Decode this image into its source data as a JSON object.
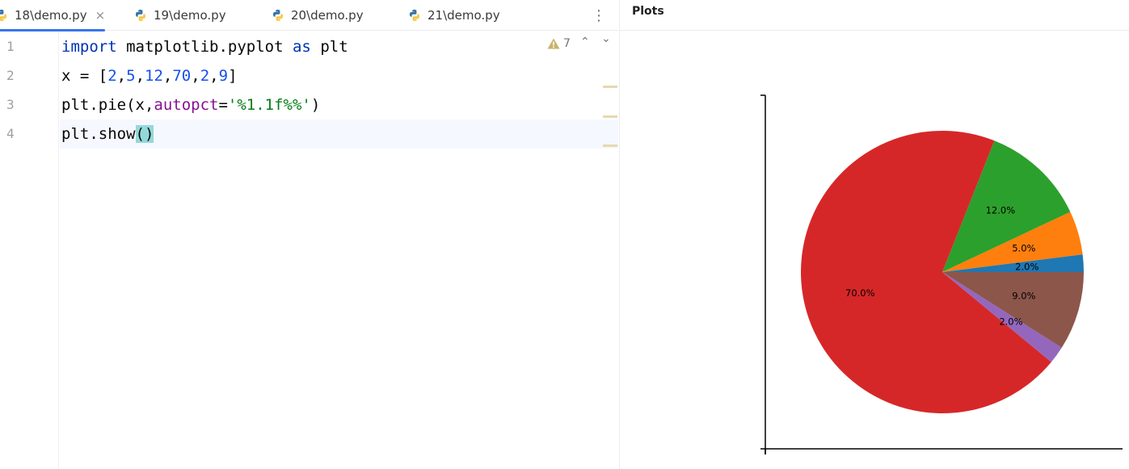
{
  "editor": {
    "tabs": [
      {
        "label": "18\\demo.py",
        "active": true
      },
      {
        "label": "19\\demo.py",
        "active": false
      },
      {
        "label": "20\\demo.py",
        "active": false
      },
      {
        "label": "21\\demo.py",
        "active": false
      }
    ],
    "close_glyph": "×",
    "more_glyph": "⋮",
    "line_numbers": [
      "1",
      "2",
      "3",
      "4"
    ],
    "code": {
      "line1": {
        "kw_import": "import",
        "module": " matplotlib.pyplot ",
        "kw_as": "as",
        "alias": " plt"
      },
      "line2": {
        "lhs": "x = [",
        "n1": "2",
        "n2": "5",
        "n3": "12",
        "n4": "70",
        "n5": "2",
        "n6": "9",
        "comma": ",",
        "rhs": "]"
      },
      "line3": {
        "call": "plt.pie(x,",
        "param": "autopct",
        "eq": "=",
        "str": "'%1.1f%%'",
        "close": ")"
      },
      "line4": {
        "call": "plt.show",
        "parens": "()"
      }
    },
    "inspections": {
      "warning_count": "7"
    },
    "up_arrow": "⌃",
    "down_arrow": "⌄"
  },
  "plots": {
    "title": "Plots"
  },
  "colors": {
    "accent": "#3574f0",
    "keyword": "#0033b3",
    "number": "#1750eb",
    "string": "#067d17",
    "parameter": "#871094"
  },
  "chart_data": {
    "type": "pie",
    "values": [
      2,
      5,
      12,
      70,
      2,
      9
    ],
    "labels": [
      "2.0%",
      "5.0%",
      "12.0%",
      "70.0%",
      "2.0%",
      "9.0%"
    ],
    "colors": [
      "#1f77b4",
      "#ff7f0e",
      "#2ca02c",
      "#d62728",
      "#9467bd",
      "#8c564b"
    ],
    "start_angle": 0,
    "counterclockwise": true
  }
}
